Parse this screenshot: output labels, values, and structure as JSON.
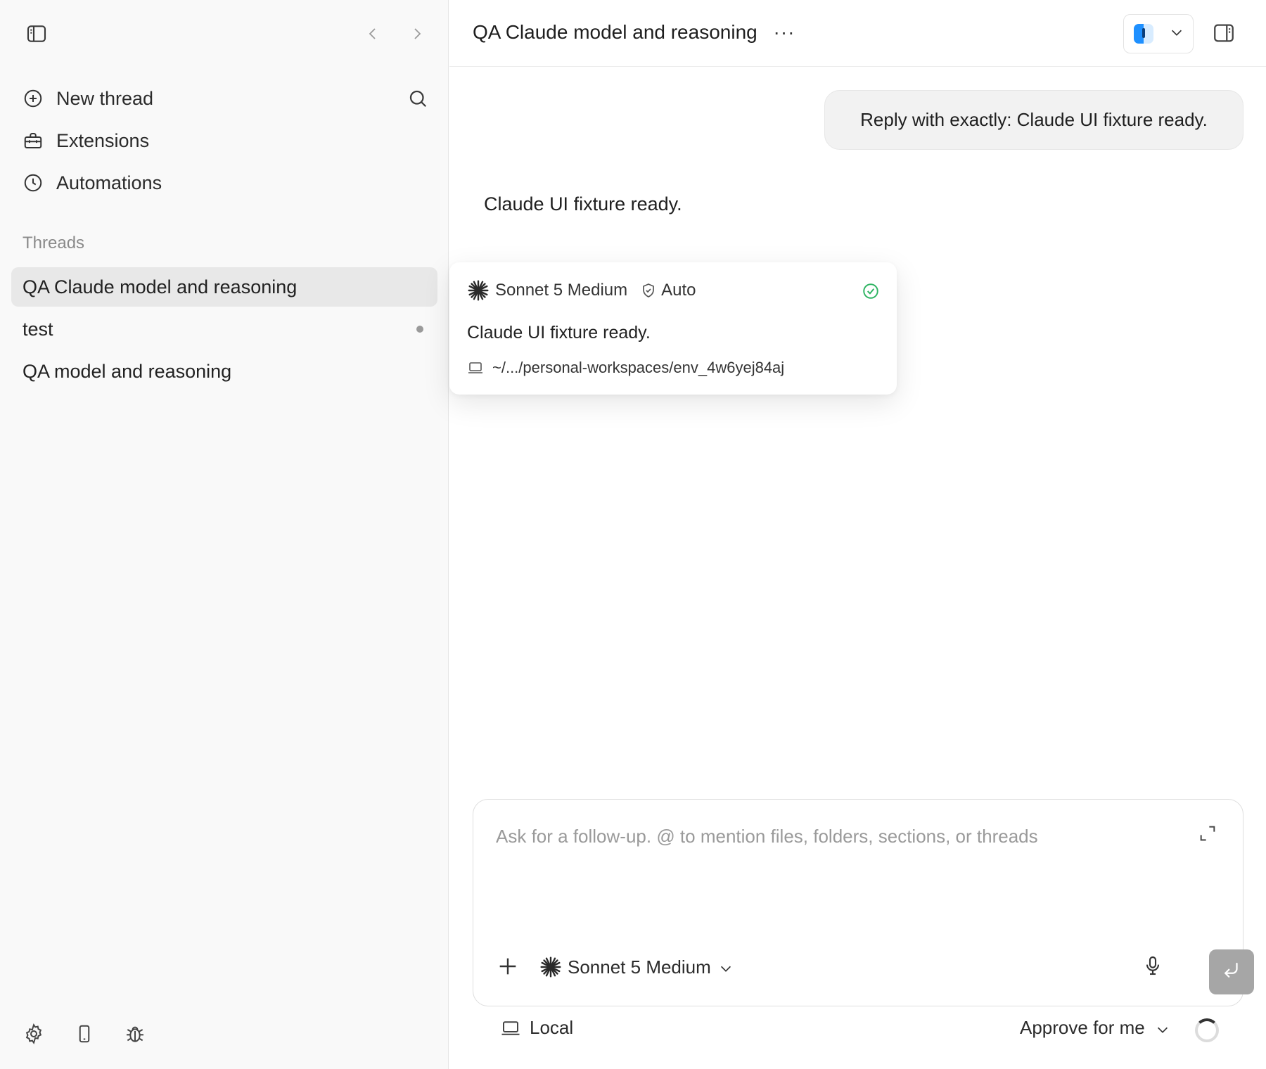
{
  "sidebar": {
    "nav": [
      {
        "label": "New thread",
        "icon": "plus-circle-icon"
      },
      {
        "label": "Extensions",
        "icon": "toolbox-icon"
      },
      {
        "label": "Automations",
        "icon": "clock-icon"
      }
    ],
    "section_label": "Threads",
    "threads": [
      {
        "label": "QA Claude model and reasoning",
        "active": true
      },
      {
        "label": "test",
        "unread": true
      },
      {
        "label": "QA model and reasoning"
      }
    ]
  },
  "header": {
    "title": "QA Claude model and reasoning",
    "more": "···"
  },
  "conversation": {
    "user_message": "Reply with exactly: Claude UI fixture ready.",
    "assistant_message": "Claude UI fixture ready."
  },
  "popup": {
    "model": "Sonnet 5 Medium",
    "mode": "Auto",
    "message": "Claude UI fixture ready.",
    "path": "~/.../personal-workspaces/env_4w6yej84aj",
    "status_color": "#2fb463"
  },
  "composer": {
    "placeholder": "Ask for a follow-up. @ to mention files, folders, sections, or threads",
    "value": "",
    "model": "Sonnet 5 Medium"
  },
  "footer": {
    "environment": "Local",
    "approval": "Approve for me"
  }
}
